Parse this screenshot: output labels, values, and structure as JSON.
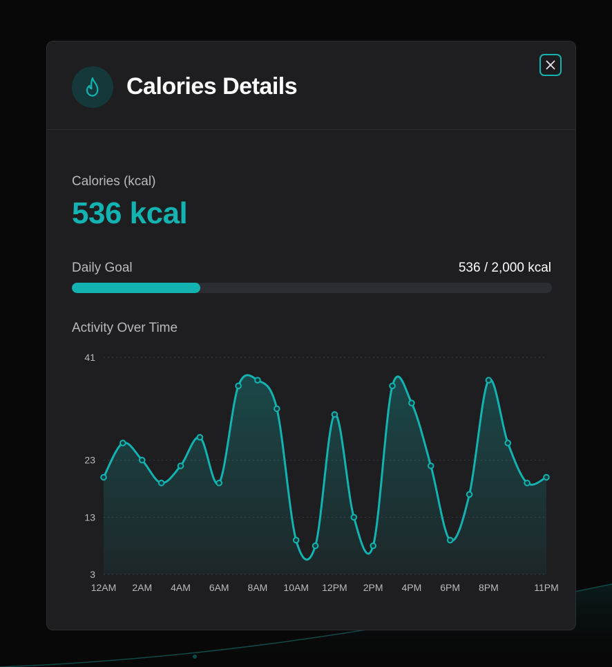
{
  "modal": {
    "title": "Calories Details",
    "icon": "flame-icon",
    "close_icon": "close-icon"
  },
  "metric": {
    "label": "Calories (kcal)",
    "value": "536 kcal"
  },
  "goal": {
    "label": "Daily Goal",
    "value_text": "536 / 2,000 kcal",
    "progress": 0.268
  },
  "activity": {
    "label": "Activity Over Time"
  },
  "colors": {
    "accent": "#12b3b1",
    "background": "#080808",
    "panel": "#1e1e20"
  },
  "chart_data": {
    "type": "area",
    "x": [
      "12AM",
      "1AM",
      "2AM",
      "3AM",
      "4AM",
      "5AM",
      "6AM",
      "7AM",
      "8AM",
      "9AM",
      "10AM",
      "11AM",
      "12PM",
      "1PM",
      "2PM",
      "3PM",
      "4PM",
      "5PM",
      "6PM",
      "7PM",
      "8PM",
      "9PM",
      "10PM",
      "11PM"
    ],
    "x_tick_labels": [
      "12AM",
      "2AM",
      "4AM",
      "6AM",
      "8AM",
      "10AM",
      "12PM",
      "2PM",
      "4PM",
      "6PM",
      "8PM",
      "11PM"
    ],
    "y_tick_labels": [
      "41",
      "23",
      "13",
      "3"
    ],
    "series": [
      {
        "values": [
          20,
          26,
          23,
          19,
          22,
          27,
          19,
          36,
          37,
          32,
          9,
          8,
          31,
          13,
          8,
          36,
          33,
          22,
          9,
          17,
          37,
          26,
          19,
          20
        ]
      }
    ],
    "ylim": [
      3,
      41
    ],
    "grid": true,
    "grid_style": "dotted"
  }
}
